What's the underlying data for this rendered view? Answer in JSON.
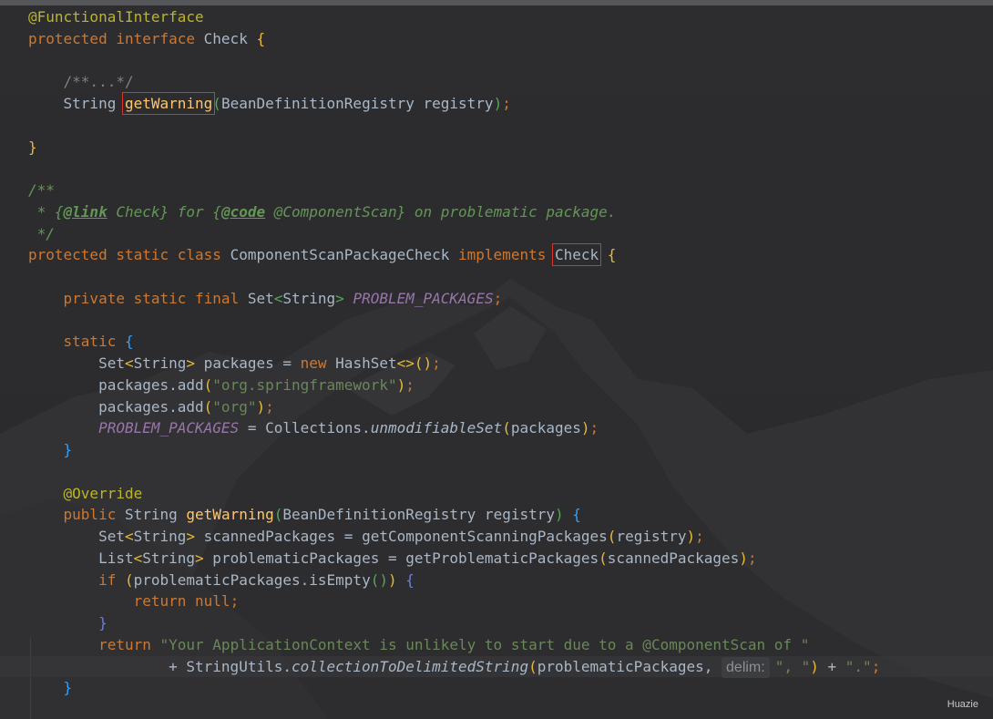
{
  "editor": {
    "lines": [
      {
        "tokens": [
          {
            "t": "@FunctionalInterface",
            "c": "ann"
          }
        ]
      },
      {
        "tokens": [
          {
            "t": "protected ",
            "c": "kw"
          },
          {
            "t": "interface ",
            "c": "kw"
          },
          {
            "t": "Check "
          },
          {
            "t": "{",
            "c": "b1"
          }
        ]
      },
      {
        "tokens": []
      },
      {
        "tokens": [
          {
            "t": "    "
          },
          {
            "t": "/**...*/",
            "c": "cmt"
          }
        ]
      },
      {
        "tokens": [
          {
            "t": "    String "
          },
          {
            "t": "getWarning",
            "c": "mth",
            "hl": true,
            "name": "get-warning-highlight"
          },
          {
            "t": "(",
            "c": "b2"
          },
          {
            "t": "BeanDefinitionRegistry registry"
          },
          {
            "t": ")",
            "c": "b2"
          },
          {
            "t": ";",
            "c": "kw"
          }
        ]
      },
      {
        "tokens": []
      },
      {
        "tokens": [
          {
            "t": "}",
            "c": "b1"
          }
        ]
      },
      {
        "tokens": []
      },
      {
        "tokens": [
          {
            "t": "/**",
            "c": "doc"
          }
        ]
      },
      {
        "tokens": [
          {
            "t": " * {",
            "c": "doc"
          },
          {
            "t": "@link",
            "c": "doctag"
          },
          {
            "t": " Check} for {",
            "c": "doc"
          },
          {
            "t": "@code",
            "c": "doctag"
          },
          {
            "t": " @ComponentScan} on problematic package.",
            "c": "doc"
          }
        ]
      },
      {
        "tokens": [
          {
            "t": " */",
            "c": "doc"
          }
        ]
      },
      {
        "tokens": [
          {
            "t": "protected ",
            "c": "kw"
          },
          {
            "t": "static ",
            "c": "kw"
          },
          {
            "t": "class ",
            "c": "kw"
          },
          {
            "t": "ComponentScanPackageCheck "
          },
          {
            "t": "implements ",
            "c": "kw"
          },
          {
            "t": "Check",
            "hl": true,
            "name": "check-highlight"
          },
          {
            "t": " "
          },
          {
            "t": "{",
            "c": "b1"
          }
        ]
      },
      {
        "tokens": []
      },
      {
        "tokens": [
          {
            "t": "    "
          },
          {
            "t": "private ",
            "c": "kw"
          },
          {
            "t": "static ",
            "c": "kw"
          },
          {
            "t": "final ",
            "c": "kw"
          },
          {
            "t": "Set"
          },
          {
            "t": "<",
            "c": "b2"
          },
          {
            "t": "String"
          },
          {
            "t": ">",
            "c": "b2"
          },
          {
            "t": " "
          },
          {
            "t": "PROBLEM_PACKAGES",
            "c": "fld"
          },
          {
            "t": ";",
            "c": "kw"
          }
        ]
      },
      {
        "tokens": []
      },
      {
        "tokens": [
          {
            "t": "    "
          },
          {
            "t": "static ",
            "c": "kw"
          },
          {
            "t": "{",
            "c": "b3"
          }
        ]
      },
      {
        "tokens": [
          {
            "t": "        Set"
          },
          {
            "t": "<",
            "c": "b1"
          },
          {
            "t": "String"
          },
          {
            "t": ">",
            "c": "b1"
          },
          {
            "t": " packages = "
          },
          {
            "t": "new ",
            "c": "kw"
          },
          {
            "t": "HashSet"
          },
          {
            "t": "<>",
            "c": "b1"
          },
          {
            "t": "()",
            "c": "b1"
          },
          {
            "t": ";",
            "c": "kw"
          }
        ]
      },
      {
        "tokens": [
          {
            "t": "        packages.add"
          },
          {
            "t": "(",
            "c": "b1"
          },
          {
            "t": "\"org.springframework\"",
            "c": "str"
          },
          {
            "t": ")",
            "c": "b1"
          },
          {
            "t": ";",
            "c": "kw"
          }
        ]
      },
      {
        "tokens": [
          {
            "t": "        packages.add"
          },
          {
            "t": "(",
            "c": "b1"
          },
          {
            "t": "\"org\"",
            "c": "str"
          },
          {
            "t": ")",
            "c": "b1"
          },
          {
            "t": ";",
            "c": "kw"
          }
        ]
      },
      {
        "tokens": [
          {
            "t": "        "
          },
          {
            "t": "PROBLEM_PACKAGES",
            "c": "fld"
          },
          {
            "t": " = Collections."
          },
          {
            "t": "unmodifiableSet",
            "c": "ital"
          },
          {
            "t": "(",
            "c": "b1"
          },
          {
            "t": "packages"
          },
          {
            "t": ")",
            "c": "b1"
          },
          {
            "t": ";",
            "c": "kw"
          }
        ]
      },
      {
        "tokens": [
          {
            "t": "    "
          },
          {
            "t": "}",
            "c": "b3"
          }
        ]
      },
      {
        "tokens": []
      },
      {
        "tokens": [
          {
            "t": "    "
          },
          {
            "t": "@Override",
            "c": "ann"
          }
        ]
      },
      {
        "tokens": [
          {
            "t": "    "
          },
          {
            "t": "public ",
            "c": "kw"
          },
          {
            "t": "String "
          },
          {
            "t": "getWarning",
            "c": "mth"
          },
          {
            "t": "(",
            "c": "b2"
          },
          {
            "t": "BeanDefinitionRegistry registry"
          },
          {
            "t": ")",
            "c": "b2"
          },
          {
            "t": " "
          },
          {
            "t": "{",
            "c": "b3"
          }
        ]
      },
      {
        "tokens": [
          {
            "t": "        Set"
          },
          {
            "t": "<",
            "c": "b1"
          },
          {
            "t": "String"
          },
          {
            "t": ">",
            "c": "b1"
          },
          {
            "t": " scannedPackages = getComponentScanningPackages"
          },
          {
            "t": "(",
            "c": "b1"
          },
          {
            "t": "registry"
          },
          {
            "t": ")",
            "c": "b1"
          },
          {
            "t": ";",
            "c": "kw"
          }
        ]
      },
      {
        "tokens": [
          {
            "t": "        List"
          },
          {
            "t": "<",
            "c": "b1"
          },
          {
            "t": "String"
          },
          {
            "t": ">",
            "c": "b1"
          },
          {
            "t": " problematicPackages = getProblematicPackages"
          },
          {
            "t": "(",
            "c": "b1"
          },
          {
            "t": "scannedPackages"
          },
          {
            "t": ")",
            "c": "b1"
          },
          {
            "t": ";",
            "c": "kw"
          }
        ]
      },
      {
        "tokens": [
          {
            "t": "        "
          },
          {
            "t": "if ",
            "c": "kw"
          },
          {
            "t": "(",
            "c": "b1"
          },
          {
            "t": "problematicPackages.isEmpty"
          },
          {
            "t": "()",
            "c": "b2"
          },
          {
            "t": ")",
            "c": "b1"
          },
          {
            "t": " "
          },
          {
            "t": "{",
            "c": "b4"
          }
        ]
      },
      {
        "tokens": [
          {
            "t": "            "
          },
          {
            "t": "return ",
            "c": "kw"
          },
          {
            "t": "null",
            "c": "kw"
          },
          {
            "t": ";",
            "c": "kw"
          }
        ]
      },
      {
        "tokens": [
          {
            "t": "        "
          },
          {
            "t": "}",
            "c": "b4"
          }
        ]
      },
      {
        "tokens": [
          {
            "t": "        "
          },
          {
            "t": "return ",
            "c": "kw"
          },
          {
            "t": "\"Your ApplicationContext is unlikely to start due to a @ComponentScan of \"",
            "c": "str"
          }
        ]
      },
      {
        "caret": true,
        "tokens": [
          {
            "t": "                + StringUtils."
          },
          {
            "t": "collectionToDelimitedString",
            "c": "ital"
          },
          {
            "t": "(",
            "c": "b1"
          },
          {
            "t": "problematicPackages, "
          },
          {
            "hint": "delim:"
          },
          {
            "t": "\", \"",
            "c": "str"
          },
          {
            "t": ")",
            "c": "b1"
          },
          {
            "t": " + "
          },
          {
            "t": "\".\"",
            "c": "str"
          },
          {
            "t": ";",
            "c": "kw"
          }
        ]
      },
      {
        "tokens": [
          {
            "t": "    "
          },
          {
            "t": "}",
            "c": "b3"
          }
        ]
      }
    ]
  },
  "watermark": "Huazie"
}
